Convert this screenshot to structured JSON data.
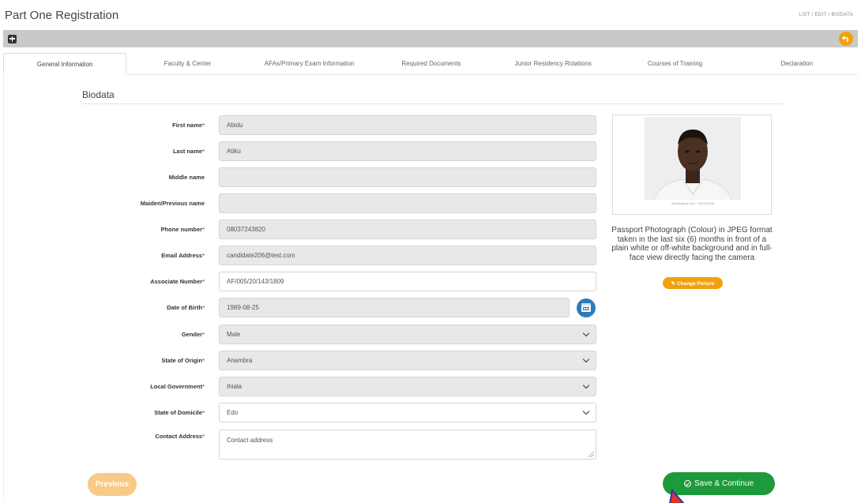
{
  "header": {
    "title": "Part One Registration",
    "breadcrumb": [
      "LIST",
      "EDIT",
      "BIODATA"
    ]
  },
  "tabs": [
    {
      "label": "General Information",
      "active": true
    },
    {
      "label": "Faculty & Center",
      "active": false
    },
    {
      "label": "AFAs/Primary Exam Information",
      "active": false
    },
    {
      "label": "Required Documents",
      "active": false
    },
    {
      "label": "Junior Residency Rotations",
      "active": false
    },
    {
      "label": "Courses of Training",
      "active": false
    },
    {
      "label": "Declaration",
      "active": false
    }
  ],
  "section": {
    "title": "Biodata"
  },
  "form": {
    "first_name": {
      "label": "First name",
      "required": "*",
      "value": "Abidu"
    },
    "last_name": {
      "label": "Last name",
      "required": "*",
      "value": "Atiku"
    },
    "middle_name": {
      "label": "Middle name",
      "required": "",
      "value": ""
    },
    "maiden_name": {
      "label": "Maiden/Previous name",
      "required": "",
      "value": ""
    },
    "phone": {
      "label": "Phone number",
      "required": "*",
      "value": "08037243820"
    },
    "email": {
      "label": "Email Address",
      "required": "*",
      "value": "candidate206@test.com"
    },
    "associate_number": {
      "label": "Associate Number",
      "required": "*",
      "value": "AF/005/20/143/1809"
    },
    "dob": {
      "label": "Date of Birth",
      "required": "*",
      "value": "1989-08-25"
    },
    "gender": {
      "label": "Gender",
      "required": "*",
      "value": "Male"
    },
    "state_origin": {
      "label": "State of Origin",
      "required": "*",
      "value": "Anambra"
    },
    "local_government": {
      "label": "Local Government",
      "required": "*",
      "value": "Ihiala"
    },
    "state_domicile": {
      "label": "State of Domicile",
      "required": "*",
      "value": "Edo"
    },
    "contact_address": {
      "label": "Contact Address",
      "required": "*",
      "placeholder": "Contact address"
    }
  },
  "photo": {
    "watermark": "shutterstock.com · 504712006",
    "note": "Passport Photograph (Colour) in JPEG format taken in the last six (6) months in front of a plain white or off-white background and in full-face view directly facing the camera",
    "change_label": "✎ Change Picture"
  },
  "buttons": {
    "previous": "Previous",
    "save": "Save & Continue"
  },
  "colors": {
    "accent_orange": "#f0a10b",
    "save_green": "#1d9a3b",
    "calendar_blue": "#2f7ab9",
    "cursor_red": "#e0342a"
  }
}
